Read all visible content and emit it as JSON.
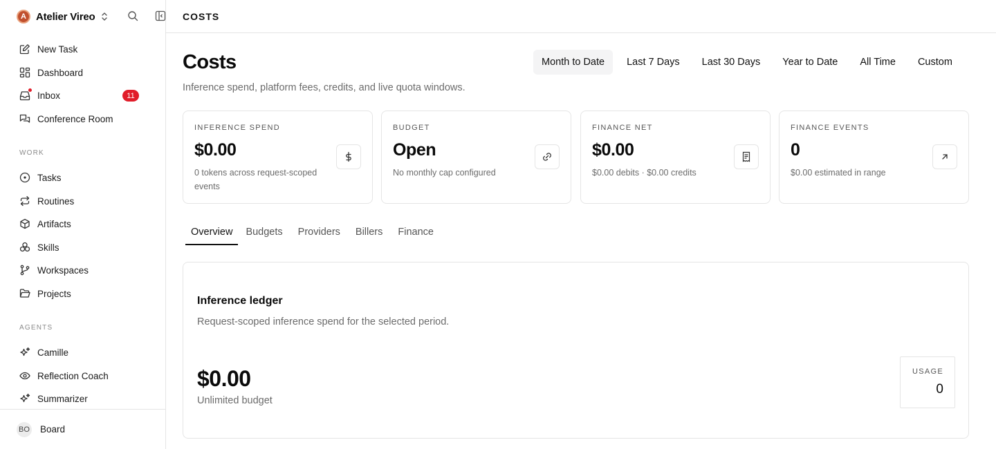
{
  "sidebar": {
    "workspace": {
      "initial": "A",
      "name": "Atelier Vireo"
    },
    "primary": [
      {
        "label": "New Task",
        "icon": "pencil-square-icon"
      },
      {
        "label": "Dashboard",
        "icon": "dashboard-icon"
      },
      {
        "label": "Inbox",
        "icon": "inbox-icon",
        "badge": "11"
      },
      {
        "label": "Conference Room",
        "icon": "chat-bubbles-icon"
      }
    ],
    "work_label": "WORK",
    "work": [
      {
        "label": "Tasks",
        "icon": "circle-dot-icon"
      },
      {
        "label": "Routines",
        "icon": "repeat-icon"
      },
      {
        "label": "Artifacts",
        "icon": "cube-icon"
      },
      {
        "label": "Skills",
        "icon": "skills-icon"
      },
      {
        "label": "Workspaces",
        "icon": "git-branch-icon"
      },
      {
        "label": "Projects",
        "icon": "folder-open-icon"
      }
    ],
    "agents_label": "AGENTS",
    "agents": [
      {
        "label": "Camille",
        "icon": "sparkles-icon"
      },
      {
        "label": "Reflection Coach",
        "icon": "eye-icon"
      },
      {
        "label": "Summarizer",
        "icon": "sparkles-icon"
      }
    ],
    "footer": {
      "avatar": "BO",
      "label": "Board"
    }
  },
  "topbar": {
    "breadcrumb": "COSTS"
  },
  "header": {
    "title": "Costs",
    "subtitle": "Inference spend, platform fees, credits, and live quota windows.",
    "ranges": [
      "Month to Date",
      "Last 7 Days",
      "Last 30 Days",
      "Year to Date",
      "All Time",
      "Custom"
    ],
    "active_range": "Month to Date"
  },
  "cards": [
    {
      "label": "INFERENCE SPEND",
      "value": "$0.00",
      "sub": "0 tokens across request-scoped events",
      "icon": "dollar-icon"
    },
    {
      "label": "BUDGET",
      "value": "Open",
      "sub": "No monthly cap configured",
      "icon": "link-icon"
    },
    {
      "label": "FINANCE NET",
      "value": "$0.00",
      "sub": "$0.00 debits · $0.00 credits",
      "icon": "receipt-icon"
    },
    {
      "label": "FINANCE EVENTS",
      "value": "0",
      "sub": "$0.00 estimated in range",
      "icon": "arrow-up-right-icon"
    }
  ],
  "tabs": [
    "Overview",
    "Budgets",
    "Providers",
    "Billers",
    "Finance"
  ],
  "active_tab": "Overview",
  "ledger": {
    "title": "Inference ledger",
    "subtitle": "Request-scoped inference spend for the selected period.",
    "amount": "$0.00",
    "amount_sub": "Unlimited budget",
    "usage_label": "USAGE",
    "usage_value": "0"
  },
  "colors": {
    "badge": "#e11d2a",
    "workspace_logo": "#c1502e",
    "border": "#e5e5e5",
    "muted_text": "#6b6b6b"
  }
}
